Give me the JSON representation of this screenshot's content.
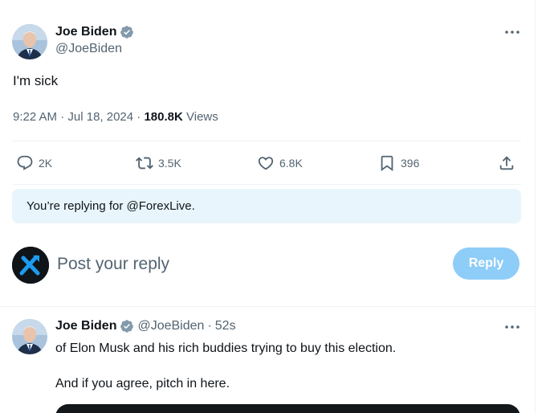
{
  "tweet": {
    "author_name": "Joe Biden",
    "author_handle": "@JoeBiden",
    "text": "I'm sick",
    "time": "9:22 AM",
    "date": "Jul 18, 2024",
    "separator": "·",
    "views_count": "180.8K",
    "views_label": "Views",
    "verified_icon": "verified-badge-icon",
    "more_icon": "more-options-icon",
    "verified_color": "#829aab"
  },
  "actions": {
    "replies": "2K",
    "retweets": "3.5K",
    "likes": "6.8K",
    "bookmarks": "396"
  },
  "reply_context": {
    "text": "You’re replying for @ForexLive."
  },
  "compose": {
    "placeholder": "Post your reply",
    "button_label": "Reply",
    "button_color": "#8ecdf8"
  },
  "reply_tweet": {
    "author_name": "Joe Biden",
    "author_handle": "@JoeBiden",
    "separator": "·",
    "time_ago": "52s",
    "line1": "of Elon Musk and his rich buddies trying to buy this election.",
    "line2": "And if you agree, pitch in here."
  },
  "colors": {
    "accent": "#1d9bf0",
    "secondary_text": "#536471",
    "reply_banner_bg": "#e8f5fd"
  }
}
